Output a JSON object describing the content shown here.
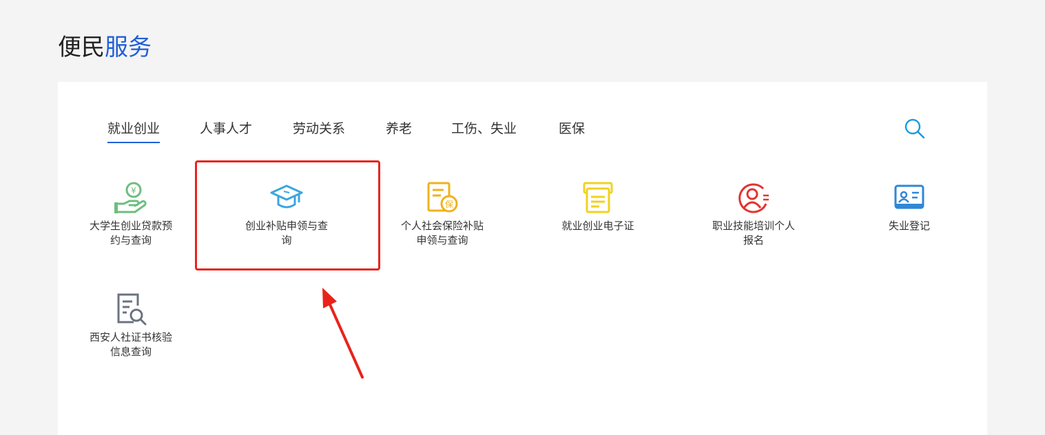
{
  "section_title": {
    "part1": "便民",
    "part2": "服务"
  },
  "tabs": [
    {
      "label": "就业创业",
      "active": true
    },
    {
      "label": "人事人才",
      "active": false
    },
    {
      "label": "劳动关系",
      "active": false
    },
    {
      "label": "养老",
      "active": false
    },
    {
      "label": "工伤、失业",
      "active": false
    },
    {
      "label": "医保",
      "active": false
    }
  ],
  "services": [
    {
      "label": "大学生创业贷款预约与查询",
      "icon": "loan-hand-icon",
      "color": "#6dbe7f"
    },
    {
      "label": "创业补贴申领与查询",
      "icon": "graduation-cap-icon",
      "color": "#3aa6e0"
    },
    {
      "label": "个人社会保险补贴申领与查询",
      "icon": "insurance-doc-icon",
      "color": "#f0b21a"
    },
    {
      "label": "就业创业电子证",
      "icon": "certificate-icon",
      "color": "#f2d21f"
    },
    {
      "label": "职业技能培训个人报名",
      "icon": "user-circle-icon",
      "color": "#e3342f"
    },
    {
      "label": "失业登记",
      "icon": "id-card-icon",
      "color": "#2f87d6"
    },
    {
      "label": "西安人社证书核验信息查询",
      "icon": "doc-search-icon",
      "color": "#6b7280"
    }
  ],
  "colors": {
    "accent": "#1f5fd6",
    "highlight": "#e8231c",
    "search": "#1a9be0"
  }
}
